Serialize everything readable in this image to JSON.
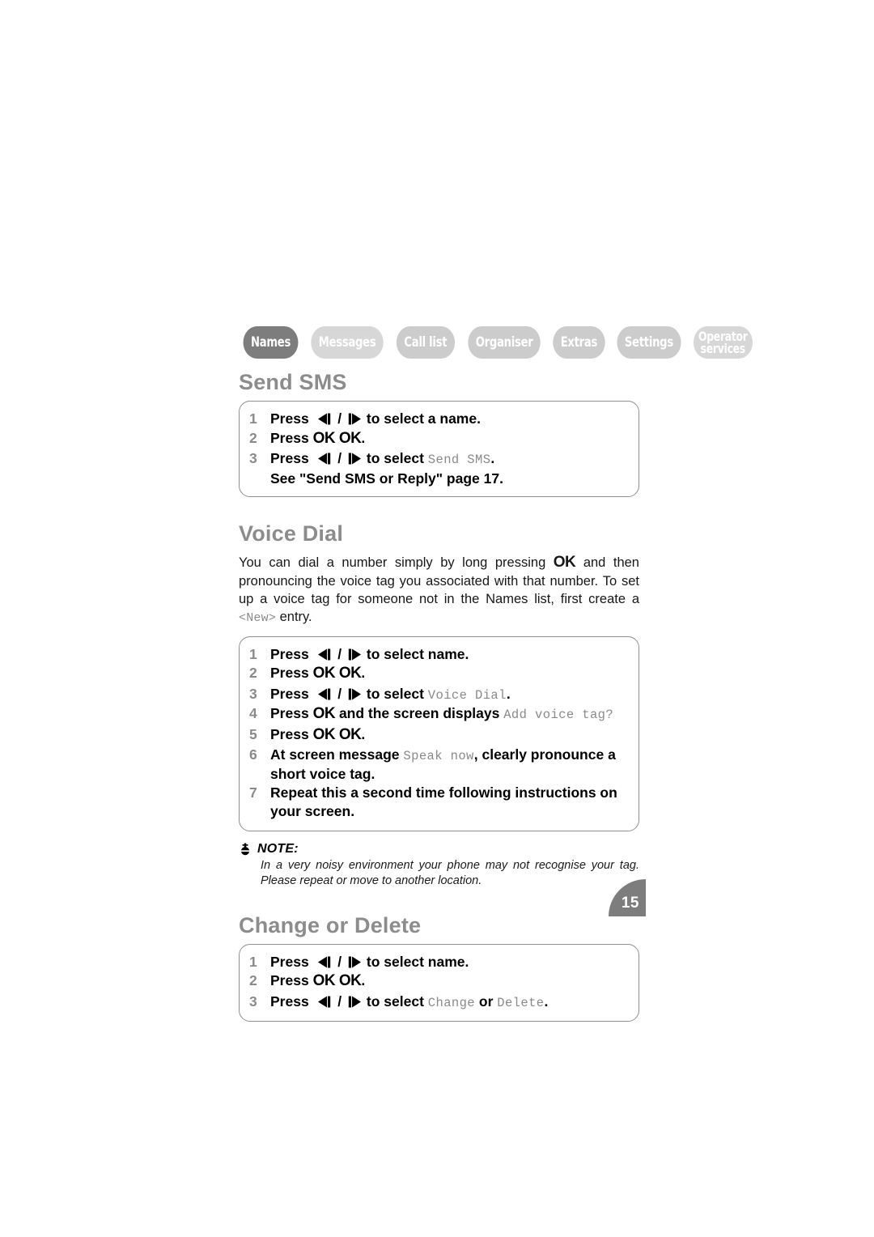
{
  "document": {
    "page_number": "15"
  },
  "tabs": [
    {
      "label": "Names",
      "active": true
    },
    {
      "label": "Messages",
      "active": false
    },
    {
      "label": "Call list",
      "active": false
    },
    {
      "label": "Organiser",
      "active": false
    },
    {
      "label": "Extras",
      "active": false
    },
    {
      "label": "Settings",
      "active": false
    },
    {
      "label_line1": "Operator",
      "label_line2": "services",
      "active": false
    }
  ],
  "sections": {
    "send_sms": {
      "heading": "Send SMS",
      "steps": [
        {
          "num": "1",
          "pre": "Press",
          "mid": "to select a name."
        },
        {
          "num": "2",
          "pre": "Press",
          "ok": "OK OK",
          "tail": "."
        },
        {
          "num": "3",
          "pre": "Press",
          "mid": "to select",
          "mono": "Send SMS",
          "tail": ".",
          "subline": "See \"Send SMS or Reply\" page 17."
        }
      ]
    },
    "voice_dial": {
      "heading": "Voice Dial",
      "paragraph_part1": "You can dial a number simply by long pressing ",
      "paragraph_ok": "OK",
      "paragraph_part2": " and then pronouncing the voice tag you associated with that number. To set up a voice tag for someone not in the Names list, first create a ",
      "paragraph_mono": "<New>",
      "paragraph_part3": " entry.",
      "steps": [
        {
          "num": "1",
          "pre": "Press",
          "mid": "to select name."
        },
        {
          "num": "2",
          "pre": "Press",
          "ok": "OK OK",
          "tail": "."
        },
        {
          "num": "3",
          "pre": "Press",
          "mid": "to select",
          "mono": "Voice Dial",
          "tail": "."
        },
        {
          "num": "4",
          "pre": "Press",
          "ok": "OK",
          "mid2": "and the screen displays",
          "mono": "Add voice tag?"
        },
        {
          "num": "5",
          "pre": "Press",
          "ok": "OK OK",
          "tail": "."
        },
        {
          "num": "6",
          "pre": "At screen message",
          "mono": "Speak now",
          "tail2": ", clearly pronounce a short voice tag."
        },
        {
          "num": "7",
          "plain": "Repeat this a second time following instructions on your screen."
        }
      ]
    },
    "note": {
      "label": "NOTE:",
      "text": "In a very noisy environment your phone may not recognise your tag. Please repeat or move to another location."
    },
    "change_or_delete": {
      "heading": "Change or Delete",
      "steps": [
        {
          "num": "1",
          "pre": "Press",
          "mid": "to select name."
        },
        {
          "num": "2",
          "pre": "Press",
          "ok": "OK OK",
          "tail": "."
        },
        {
          "num": "3",
          "pre": "Press",
          "mid": "to select",
          "mono": "Change",
          "joiner": "or",
          "mono2": "Delete",
          "tail": "."
        }
      ]
    }
  },
  "colors": {
    "heading_gray": "#8c8c8c",
    "tab_active": "#7d7d7d",
    "tab_inactive": "#cccccc",
    "box_border": "#8f8f8f",
    "mono_gray": "#8a8a8a"
  }
}
